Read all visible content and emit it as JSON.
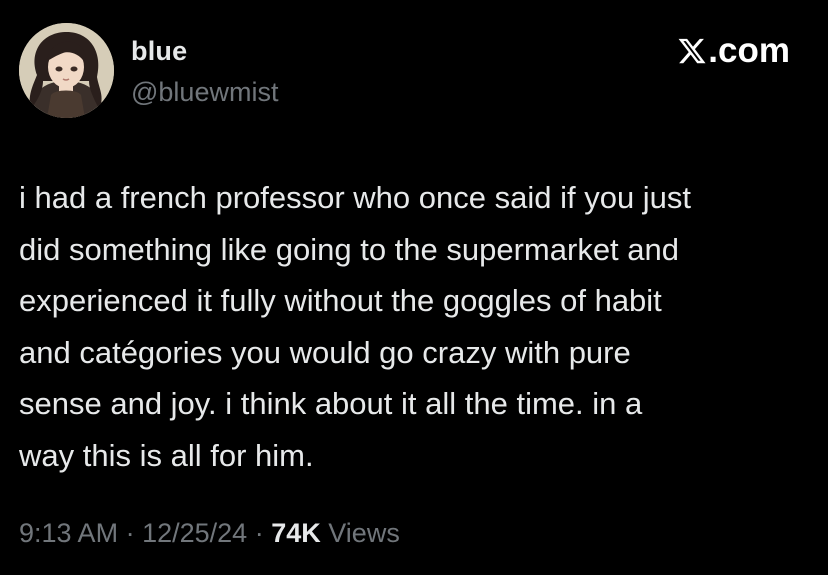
{
  "author": {
    "display_name": "blue",
    "handle": "@bluewmist",
    "avatar_icon": "anime-girl-avatar"
  },
  "brand": {
    "label": ".com",
    "logo_icon": "x-logo-icon"
  },
  "tweet": {
    "lines": [
      "i had a french professor who once said if you just",
      "did something like going to the supermarket and",
      "experienced it fully without the goggles of habit",
      "and catégories you would go crazy with pure",
      "sense and joy. i think about it all the time. in a",
      "way this is all for him."
    ]
  },
  "meta": {
    "time": "9:13 AM",
    "separator": "·",
    "date": "12/25/24",
    "views_count": "74K",
    "views_label": "Views"
  },
  "colors": {
    "background": "#000000",
    "text_primary": "#e7e9ea",
    "text_secondary": "#71767b"
  }
}
